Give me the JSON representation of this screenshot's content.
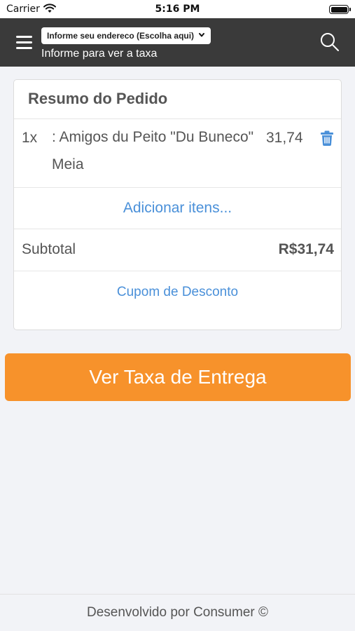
{
  "status_bar": {
    "carrier": "Carrier",
    "time": "5:16 PM",
    "icons": [
      "wifi-icon",
      "battery-icon"
    ]
  },
  "header": {
    "menu_icon": "hamburger-menu-icon",
    "address_select_value": "Informe seu endereco (Escolha aqui)",
    "address_hint": "Informe para ver a taxa",
    "search_icon": "search-icon",
    "background_color": "#3a3a3a"
  },
  "order_summary": {
    "title": "Resumo do Pedido",
    "items": [
      {
        "quantity": "1x",
        "name": ": Amigos du Peito \"Du Buneco\" Meia",
        "price": "31,74",
        "delete_icon": "trash-icon"
      }
    ],
    "add_items_label": "Adicionar itens...",
    "subtotal_label": "Subtotal",
    "subtotal_value": "R$31,74",
    "coupon_label": "Cupom de Desconto",
    "link_color": "#4a90d9"
  },
  "cta": {
    "label": "Ver Taxa de Entrega",
    "color": "#f7922b"
  },
  "footer": {
    "text": "Desenvolvido por Consumer ©"
  }
}
